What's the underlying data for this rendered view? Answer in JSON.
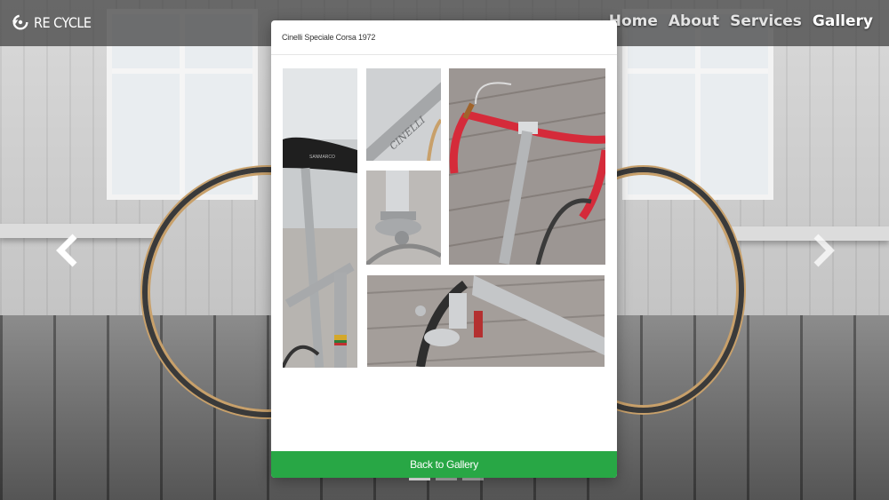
{
  "brand": {
    "logo_text": "RE CYCLE"
  },
  "nav": {
    "items": [
      {
        "label": "Home"
      },
      {
        "label": "About"
      },
      {
        "label": "Services"
      },
      {
        "label": "Gallery"
      }
    ],
    "active": "Gallery"
  },
  "modal": {
    "title": "Cinelli Speciale Corsa 1972",
    "back_label": "Back to Gallery",
    "button_color": "#28a745"
  },
  "carousel": {
    "prev_icon": "chevron-left-icon",
    "next_icon": "chevron-right-icon",
    "indicators": 3,
    "active_indicator": 0
  },
  "photos": {
    "frame_label_text": "CINELLI",
    "saddle_label_text": "SANMARCO"
  }
}
